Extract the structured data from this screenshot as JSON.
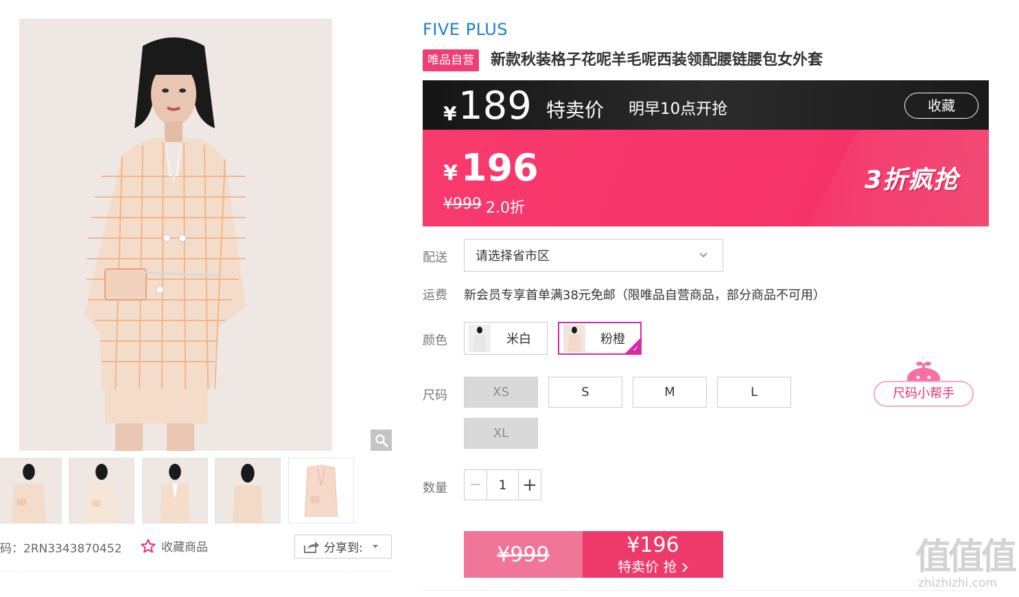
{
  "gallery": {
    "sku_code": "码：2RN3343870452",
    "favorite_label": "收藏商品",
    "share_label": "分享到:",
    "thumbnails": [
      "thumb-model-front",
      "thumb-model-front-2",
      "thumb-model-open",
      "thumb-model-back",
      "thumb-product-flat"
    ]
  },
  "product": {
    "brand": "FIVE PLUS",
    "tag": "唯品自营",
    "title": "新款秋装格子花呢羊毛呢西装领配腰链腰包女外套"
  },
  "presale": {
    "yen": "¥",
    "price": "189",
    "label": "特卖价",
    "time": "明早10点开抢",
    "collect": "收藏"
  },
  "current": {
    "yen": "¥",
    "price": "196",
    "original": "¥999",
    "discount": "2.0折",
    "slogan": "3折疯抢"
  },
  "delivery": {
    "label": "配送",
    "placeholder": "请选择省市区"
  },
  "freight": {
    "label": "运费",
    "text": "新会员专享首单满38元免邮（限唯品自营商品，部分商品不可用）"
  },
  "color": {
    "label": "颜色",
    "options": [
      {
        "name": "米白",
        "selected": false
      },
      {
        "name": "粉橙",
        "selected": true
      }
    ]
  },
  "size": {
    "label": "尺码",
    "options": [
      {
        "name": "XS",
        "available": false
      },
      {
        "name": "S",
        "available": true
      },
      {
        "name": "M",
        "available": true
      },
      {
        "name": "L",
        "available": true
      },
      {
        "name": "XL",
        "available": false
      }
    ],
    "helper": "尺码小帮手"
  },
  "quantity": {
    "label": "数量",
    "value": "1",
    "minus": "−",
    "plus": "+"
  },
  "buy": {
    "original": "¥999",
    "price": "¥196",
    "action": "特卖价 抢"
  },
  "watermark": {
    "chars": "值值值",
    "url": "zhizhizhi.com"
  },
  "colors": {
    "accent_pink": "#ee3a6b",
    "brand_blue": "#1a80d2",
    "select_magenta": "#d829a6"
  }
}
